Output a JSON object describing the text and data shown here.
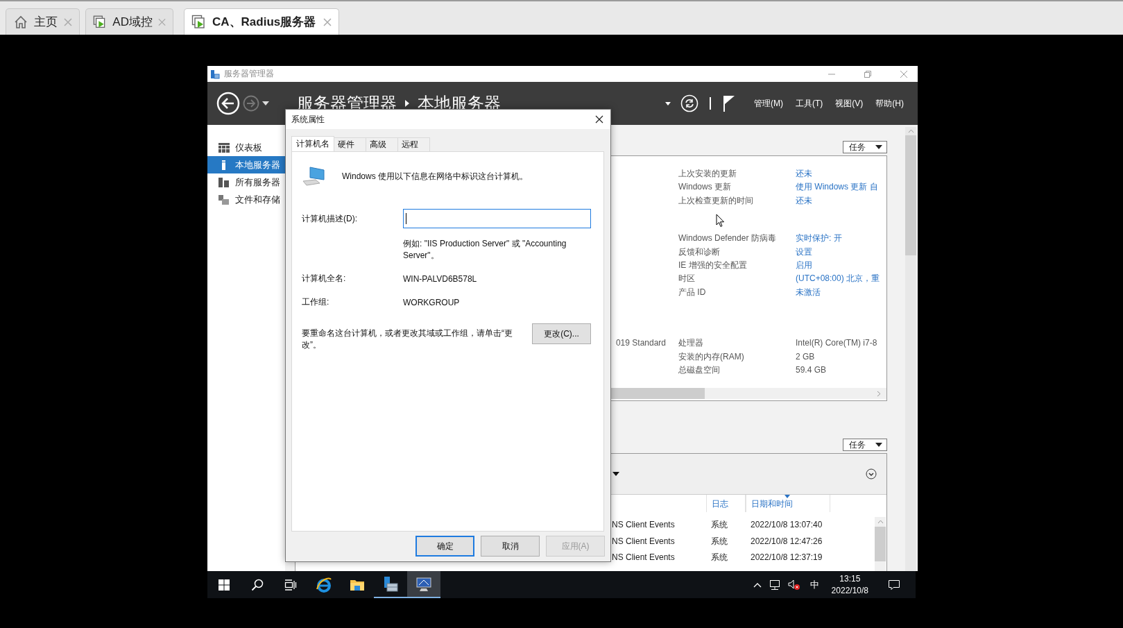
{
  "browser_tabs": [
    {
      "label": "主页",
      "kind": "home",
      "selected": false
    },
    {
      "label": "AD域控",
      "kind": "vm",
      "selected": false
    },
    {
      "label": "CA、Radius服务器",
      "kind": "vm",
      "selected": true
    }
  ],
  "server_manager": {
    "title": "服务器管理器",
    "breadcrumb": [
      "服务器管理器",
      "本地服务器"
    ],
    "menus": [
      "管理(M)",
      "工具(T)",
      "视图(V)",
      "帮助(H)"
    ],
    "sidebar": [
      {
        "label": "仪表板",
        "kind": "dashboard",
        "selected": false
      },
      {
        "label": "本地服务器",
        "kind": "local",
        "selected": true
      },
      {
        "label": "所有服务器",
        "kind": "servers",
        "selected": false
      },
      {
        "label": "文件和存储",
        "kind": "storage",
        "selected": false
      }
    ],
    "properties": {
      "task_button": "任务",
      "groups": [
        [
          {
            "label": "上次安装的更新",
            "value": "还未",
            "link": true
          },
          {
            "label": "Windows 更新",
            "value": "使用 Windows 更新 自",
            "link": true
          },
          {
            "label": "上次检查更新的时间",
            "value": "还未",
            "link": true
          }
        ],
        [
          {
            "label": "Windows Defender 防病毒",
            "value": "实时保护: 开",
            "link": true
          },
          {
            "label": "反馈和诊断",
            "value": "设置",
            "link": true
          },
          {
            "label": "IE 增强的安全配置",
            "value": "启用",
            "link": true
          },
          {
            "label": "时区",
            "value": "(UTC+08:00) 北京，重",
            "link": true
          },
          {
            "label": "产品 ID",
            "value": "未激活",
            "link": true
          }
        ],
        [
          {
            "left": "019 Standard",
            "label": "处理器",
            "value": "Intel(R) Core(TM) i7-8",
            "link": false
          },
          {
            "label": "安装的内存(RAM)",
            "value": "2 GB",
            "link": false
          },
          {
            "label": "总磁盘空间",
            "value": "59.4 GB",
            "link": false
          }
        ]
      ]
    },
    "events": {
      "task_button": "任务",
      "columns": [
        "日志",
        "日期和时间"
      ],
      "rows": [
        {
          "source": "NS Client Events",
          "log": "系统",
          "datetime": "2022/10/8 13:07:40"
        },
        {
          "source": "NS Client Events",
          "log": "系统",
          "datetime": "2022/10/8 12:47:26"
        },
        {
          "source": "NS Client Events",
          "log": "系统",
          "datetime": "2022/10/8 12:37:19"
        }
      ]
    }
  },
  "dialog": {
    "title": "系统属性",
    "tabs": [
      {
        "label": "计算机名",
        "selected": true
      },
      {
        "label": "硬件",
        "selected": false
      },
      {
        "label": "高级",
        "selected": false
      },
      {
        "label": "远程",
        "selected": false
      }
    ],
    "intro": "Windows 使用以下信息在网络中标识这台计算机。",
    "description_label": "计算机描述(D):",
    "hint": "例如: \"IIS Production Server\" 或 \"Accounting Server\"。",
    "fields": [
      {
        "label": "计算机全名:",
        "value": "WIN-PALVD6B578L"
      },
      {
        "label": "工作组:",
        "value": "WORKGROUP"
      }
    ],
    "rename_text": "要重命名这台计算机，或者更改其域或工作组，请单击“更改”。",
    "change_button": "更改(C)...",
    "buttons": [
      {
        "label": "确定",
        "default": true,
        "disabled": false
      },
      {
        "label": "取消",
        "default": false,
        "disabled": false
      },
      {
        "label": "应用(A)",
        "default": false,
        "disabled": true
      }
    ]
  },
  "taskbar": {
    "apps": [
      {
        "kind": "start",
        "running": false,
        "active": false
      },
      {
        "kind": "search",
        "running": false,
        "active": false
      },
      {
        "kind": "taskview",
        "running": false,
        "active": false
      },
      {
        "kind": "ie",
        "running": false,
        "active": false
      },
      {
        "kind": "explorer",
        "running": false,
        "active": false
      },
      {
        "kind": "servermanager",
        "running": true,
        "active": false
      },
      {
        "kind": "sysprops",
        "running": true,
        "active": true
      }
    ],
    "ime": "中",
    "time": "13:15",
    "date": "2022/10/8"
  }
}
